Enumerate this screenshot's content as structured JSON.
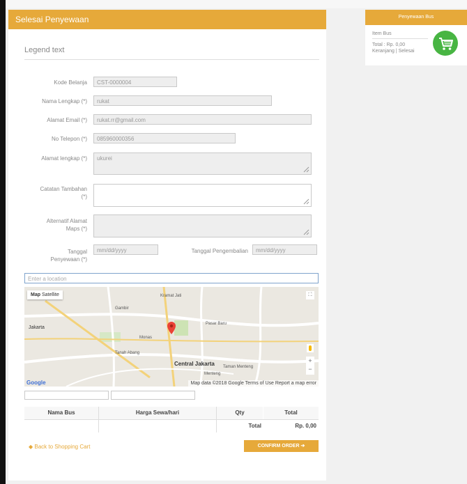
{
  "panel": {
    "title": "Selesai Penyewaan",
    "legend": "Legend text"
  },
  "form": {
    "kode_label": "Kode Belanja",
    "kode_value": "CST-0000004",
    "nama_label": "Nama Lengkap (*)",
    "nama_value": "rukat",
    "email_label": "Alamat Email (*)",
    "email_value": "rukat.rr@gmail.com",
    "telp_label": "No Telepon (*)",
    "telp_value": "085960000356",
    "alamat_label": "Alamat lengkap (*)",
    "alamat_value": "ukurei",
    "catatan_label_1": "Catatan Tambahan",
    "catatan_label_2": "(*)",
    "alternatif_label_1": "Alternatif Alamat",
    "alternatif_label_2": "Maps (*)",
    "tgl_sewa_label_1": "Tanggal",
    "tgl_sewa_label_2": "Penyewaan (*)",
    "tgl_sewa_placeholder": "mm/dd/yyyy",
    "tgl_kembali_label": "Tanggal Pengembalian",
    "tgl_kembali_placeholder": "mm/dd/yyyy",
    "location_placeholder": "Enter a location"
  },
  "map": {
    "maptype_map": "Map",
    "maptype_satellite": "Satellite",
    "google": "Google",
    "footer": "Map data ©2018 Google   Terms of Use   Report a map error",
    "labels": [
      "Jakarta",
      "Central Jakarta",
      "Kramat Jati",
      "Menteng",
      "Tanah Abang",
      "Taman Menteng",
      "Pasar Baru",
      "Monas",
      "Gambir"
    ]
  },
  "table": {
    "headers": [
      "Nama Bus",
      "Harga Sewa/hari",
      "Qty",
      "Total"
    ],
    "total_label": "Total",
    "total_value": "Rp. 0,00"
  },
  "actions": {
    "back": "Back to Shopping Cart",
    "confirm": "CONFIRM ORDER"
  },
  "widget": {
    "title": "Penyewaan Bus",
    "item": "Item Bus",
    "total": "Total : Rp. 0,00",
    "links": "Keranjang | Selesai"
  },
  "colors": {
    "accent": "#e6a93a",
    "cart": "#48b543"
  }
}
